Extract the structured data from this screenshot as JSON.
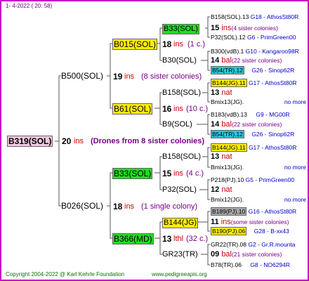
{
  "header": {
    "date": "1-  4-2022 ( 20: 58)"
  },
  "footer": {
    "copyright": "Copyright 2004-2022 @ Karl Kehrle Foundation",
    "site": "www.pedigreeapis.org"
  },
  "colors": {
    "frame": "#c800c8",
    "lines": "#555555",
    "highlight_green": "#22dd22",
    "highlight_yellow": "#ffee00",
    "highlight_cyan": "#22ccdd"
  },
  "root": {
    "name": "B319(SOL)",
    "ins": "20",
    "ins_label": "ins",
    "note": "(Drones from 8 sister colonies)"
  },
  "gen1": {
    "top": {
      "name": "B500(SOL)",
      "ins": "19",
      "ins_label": "ins",
      "note": "(8 sister colonies)"
    },
    "bottom": {
      "name": "B026(SOL)",
      "ins": "18",
      "ins_label": "ins",
      "note": "(1 single colony)"
    }
  },
  "gen2": {
    "a": {
      "name": "B015(SOL)",
      "ins": "18",
      "ins_label": "ins",
      "note": "(1 c.)"
    },
    "b": {
      "name": "B61(SOL)",
      "ins": "16",
      "ins_label": "ins",
      "note": "(10 c.)"
    },
    "c": {
      "name": "B33(SOL)",
      "ins": "15",
      "ins_label": "ins",
      "note": "(4 c.)"
    },
    "d": {
      "name": "B366(MD)",
      "ins": "13",
      "ins_label": "lthl",
      "note": "(32 c.)"
    }
  },
  "gen3": {
    "a1": {
      "name": "B33(SOL)",
      "ins": "15",
      "ins_label": "ins",
      "note": "(4 sister colonies)"
    },
    "a2": {
      "name": "B30(SOL)",
      "ins": "14",
      "ins_label": "bal",
      "note": "(22 sister colonies)"
    },
    "b1": {
      "name": "B158(SOL)",
      "ins": "13",
      "ins_label": "nat",
      "note": ""
    },
    "b2": {
      "name": "B9(SOL)",
      "ins": "14",
      "ins_label": "bal",
      "note": "(22 sister colonies)"
    },
    "c1": {
      "name": "B158(SOL)",
      "ins": "13",
      "ins_label": "nat",
      "note": ""
    },
    "c2": {
      "name": "P32(SOL)",
      "ins": "12",
      "ins_label": "nat",
      "note": ""
    },
    "d1": {
      "name": "B144(JG)",
      "ins": "11",
      "ins_label": "ins",
      "note": "(some sister colonies)"
    },
    "d2": {
      "name": "GR23(TR)",
      "ins": "09",
      "ins_label": "bal",
      "note": "(21 sister colonies)"
    }
  },
  "gen4": [
    {
      "left": "B158(SOL).13",
      "mid": "G18 -",
      "right": "AthosSt80R"
    },
    {
      "left": "P32(SOL).12",
      "mid": "G6 -",
      "right": "PrimGreen00"
    },
    {
      "left": "B300(vdB).1",
      "mid": "G10 -",
      "right": "Kangaroo98R"
    },
    {
      "left": "B54(TR).12",
      "mid": "G26 -",
      "right": "Sinop62R"
    },
    {
      "left": "B144(JG).11",
      "mid": "G17 -",
      "right": "AthosSt80R"
    },
    {
      "left": "Bmix13(JG).",
      "mid": "",
      "right": "no more"
    },
    {
      "left": "B183(vdB).13",
      "mid": "G9 -",
      "right": "MG00R"
    },
    {
      "left": "B54(TR).12",
      "mid": "G26 -",
      "right": "Sinop62R"
    },
    {
      "left": "B144(JG).11",
      "mid": "G17 -",
      "right": "AthosSt80R"
    },
    {
      "left": "Bmix13(JG).",
      "mid": "",
      "right": "no more"
    },
    {
      "left": "P218(PJ).10",
      "mid": "G5 -",
      "right": "PrimGreen00"
    },
    {
      "left": "Bmix12(JG).",
      "mid": "",
      "right": "no more"
    },
    {
      "left": "B189(PJ).10",
      "mid": "G16 -",
      "right": "AthosSt80R"
    },
    {
      "left": "B190(PJ).06",
      "mid": "G28 -",
      "right": "B-xx43"
    },
    {
      "left": "GR22(TR).08",
      "mid": "G2 -",
      "right": "Gr.R.mounta"
    },
    {
      "left": "B78(TR).06",
      "mid": "G8 -",
      "right": "NO6294R"
    }
  ]
}
